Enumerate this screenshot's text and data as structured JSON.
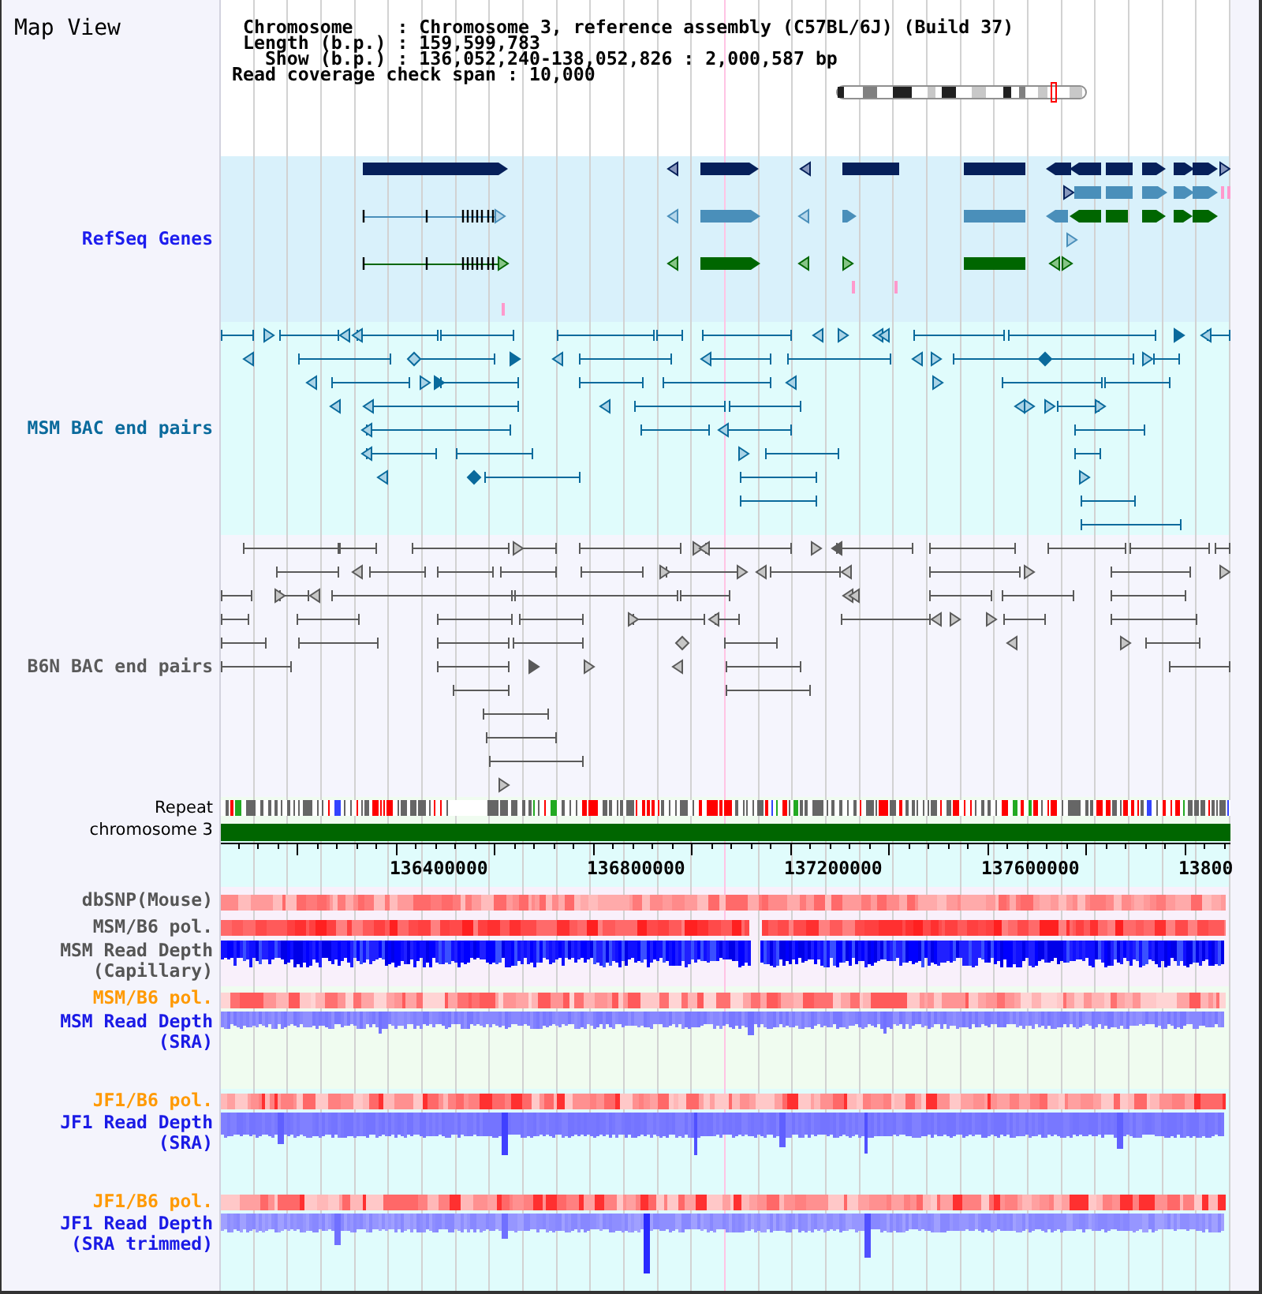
{
  "title": "Map View",
  "info_lines": [
    " Chromosome    : Chromosome 3, reference assembly (C57BL/6J) (Build 37)",
    " Length (b.p.) : 159,599,783",
    "   Show (b.p.) : 136,052,240-138,052,826 : 2,000,587 bp",
    "Read coverage check span : 10,000"
  ],
  "tracks": [
    {
      "kind": "genes",
      "label": "RefSeq Genes",
      "color": "#1c1cee"
    },
    {
      "kind": "bacpairs",
      "label": "MSM BAC end pairs",
      "color": "#0a6a9c"
    },
    {
      "kind": "bacpairs",
      "label": "B6N BAC end pairs",
      "color": "#5a5a5a"
    },
    {
      "kind": "repeat",
      "label": "Repeat"
    },
    {
      "kind": "chromosome",
      "label": "chromosome 3"
    },
    {
      "kind": "ruler",
      "labels": [
        "136400000",
        "136800000",
        "137200000",
        "137600000",
        "13800"
      ]
    },
    {
      "kind": "heat",
      "label": "dbSNP(Mouse)",
      "color": "#555555"
    },
    {
      "kind": "heat",
      "label": "MSM/B6 pol.",
      "color": "#555555"
    },
    {
      "kind": "depth",
      "label": "MSM Read Depth (Capillary)",
      "color": "#555555"
    },
    {
      "kind": "heat",
      "label": "MSM/B6 pol.",
      "color": "#ff9900"
    },
    {
      "kind": "depth",
      "label": "MSM Read Depth (SRA)",
      "color": "#1a1ae6"
    },
    {
      "kind": "heat",
      "label": "JF1/B6 pol.",
      "color": "#ff9900"
    },
    {
      "kind": "depth",
      "label": "JF1 Read Depth (SRA)",
      "color": "#1a1ae6"
    },
    {
      "kind": "heat",
      "label": "JF1/B6 pol.",
      "color": "#ff9900"
    },
    {
      "kind": "depth",
      "label": "JF1 Read Depth (SRA trimmed)",
      "color": "#1a1ae6"
    }
  ]
}
